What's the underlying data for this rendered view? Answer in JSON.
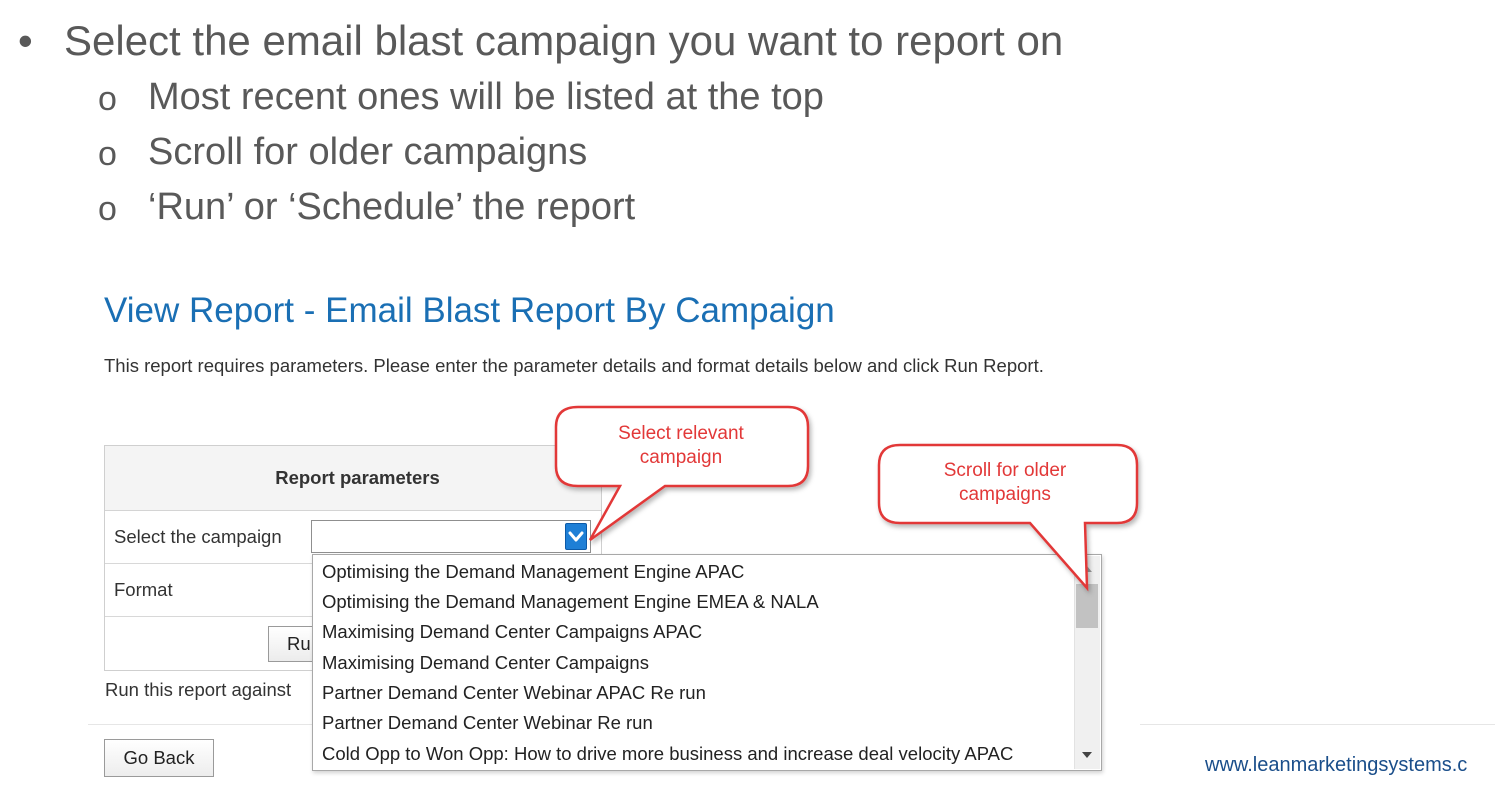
{
  "slide": {
    "bullet_marker": "•",
    "bullet_main": "Select the email blast campaign you want to report on",
    "sub_marker": "o",
    "sub_bullets": [
      "Most recent ones will be listed at the top",
      "Scroll for older campaigns",
      "‘Run’ or ‘Schedule’ the report"
    ]
  },
  "report": {
    "title": "View Report - Email Blast Report By Campaign",
    "description": "This report requires parameters. Please enter the parameter details and format details below and click Run Report.",
    "params_header": "Report parameters",
    "select_campaign_label": "Select the campaign",
    "format_label": "Format",
    "run_button_label": "Ru",
    "run_against_text": "Run this report against",
    "go_back_label": "Go Back"
  },
  "dropdown": {
    "items": [
      "Optimising the Demand Management Engine APAC",
      "Optimising the Demand Management Engine EMEA & NALA",
      "Maximising Demand Center Campaigns APAC",
      "Maximising Demand Center Campaigns",
      "Partner Demand Center Webinar APAC Re run",
      "Partner Demand Center Webinar Re run",
      "Cold Opp to Won Opp: How to drive more business and increase deal velocity APAC"
    ]
  },
  "callouts": {
    "select_campaign": [
      "Select relevant",
      "campaign"
    ],
    "scroll_older": [
      "Scroll for older",
      "campaigns"
    ]
  },
  "footer": {
    "url": "www.leanmarketingsystems.c"
  },
  "colors": {
    "title_blue": "#1a6fb4",
    "callout_red": "#e23838",
    "slide_gray": "#595959"
  }
}
